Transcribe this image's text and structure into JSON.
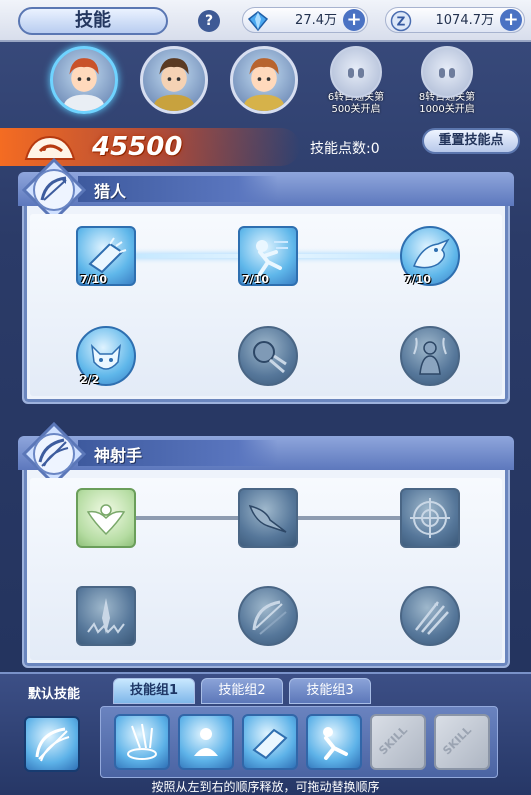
{
  "header": {
    "title": "技能",
    "help_label": "?",
    "currency1": {
      "value": "27.4万",
      "icon": "blue-diamond-icon",
      "plus": "+"
    },
    "currency2": {
      "value": "1074.7万",
      "icon": "z-coin-icon",
      "plus": "+"
    }
  },
  "heroes": {
    "slots": [
      {
        "icon": "hero-portrait-1",
        "active": true
      },
      {
        "icon": "hero-portrait-2",
        "active": false
      },
      {
        "icon": "hero-portrait-3",
        "active": false
      }
    ],
    "locked": [
      {
        "line1": "6转目通关第",
        "line2": "500关开启"
      },
      {
        "line1": "8转目通关第",
        "line2": "1000关开启"
      }
    ]
  },
  "power": {
    "value": "45500",
    "skill_points_label": "技能点数:0",
    "reset_label": "重置技能点"
  },
  "panels": [
    {
      "name": "猎人",
      "skills": [
        {
          "icon": "ice-gauntlet-icon",
          "level": "7/10",
          "state": "on",
          "shape": "sq"
        },
        {
          "icon": "running-figure-icon",
          "level": "7/10",
          "state": "on",
          "shape": "sq"
        },
        {
          "icon": "dragon-head-icon",
          "level": "7/10",
          "state": "on",
          "shape": "circ"
        },
        {
          "icon": "wolf-head-icon",
          "level": "2/2",
          "state": "on",
          "shape": "circ"
        },
        {
          "icon": "fist-strike-icon",
          "level": "",
          "state": "off",
          "shape": "circ"
        },
        {
          "icon": "spirit-figure-icon",
          "level": "",
          "state": "off",
          "shape": "circ"
        }
      ]
    },
    {
      "name": "神射手",
      "skills": [
        {
          "icon": "eagle-emblem-icon",
          "level": "",
          "state": "green",
          "shape": "sq"
        },
        {
          "icon": "hawk-dive-icon",
          "level": "",
          "state": "off",
          "shape": "sq"
        },
        {
          "icon": "crosshair-target-icon",
          "level": "",
          "state": "off",
          "shape": "sq"
        },
        {
          "icon": "crystal-spikes-icon",
          "level": "",
          "state": "off",
          "shape": "sq"
        },
        {
          "icon": "bow-arrows-icon",
          "level": "",
          "state": "off",
          "shape": "circ"
        },
        {
          "icon": "multi-arrow-icon",
          "level": "",
          "state": "off",
          "shape": "circ"
        }
      ]
    }
  ],
  "bottom": {
    "default_label": "默认技能",
    "tabs": [
      "技能组1",
      "技能组2",
      "技能组3"
    ],
    "selected_tab": 0,
    "slots": [
      {
        "icon": "arrow-rain-icon",
        "filled": true
      },
      {
        "icon": "meditate-figure-icon",
        "filled": true
      },
      {
        "icon": "ice-gauntlet-icon",
        "filled": true
      },
      {
        "icon": "running-figure-icon",
        "filled": true
      },
      {
        "icon": "",
        "filled": false,
        "text": "SKILL"
      },
      {
        "icon": "",
        "filled": false,
        "text": "SKILL"
      }
    ],
    "hint": "按照从左到右的顺序释放，可拖动替换顺序"
  },
  "colors": {
    "accent_blue": "#5a77b3",
    "flame": "#ff6e1e",
    "panel_header": "#5d78bd"
  }
}
